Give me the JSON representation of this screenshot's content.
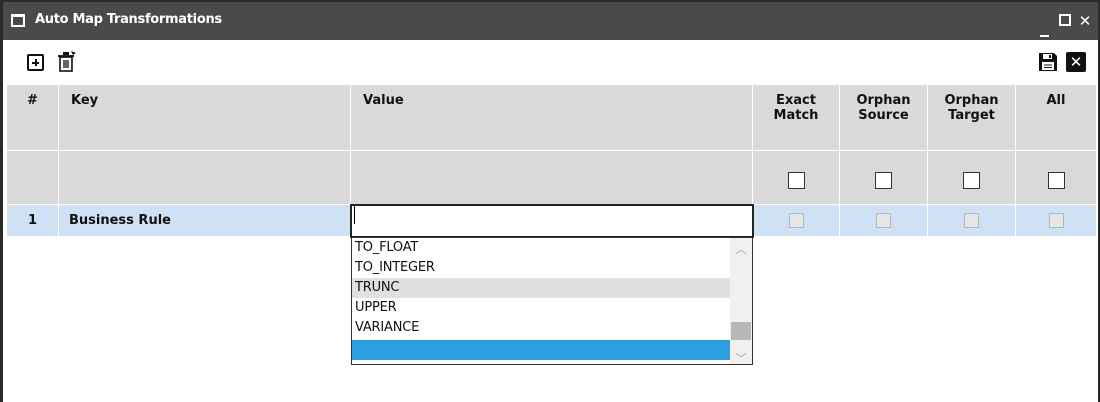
{
  "window": {
    "title": "Auto Map Transformations",
    "controls": [
      "minimize",
      "maximize",
      "close"
    ]
  },
  "toolbar": {
    "add_icon": "add-square-icon",
    "delete_icon": "trash-icon",
    "save_icon": "floppy-disk-icon",
    "close_icon": "close-x-icon"
  },
  "grid": {
    "columns": [
      {
        "key": "num",
        "label": "#"
      },
      {
        "key": "key",
        "label": "Key"
      },
      {
        "key": "value",
        "label": "Value"
      },
      {
        "key": "exact_match",
        "label": "Exact Match"
      },
      {
        "key": "orphan_source",
        "label": "Orphan Source"
      },
      {
        "key": "orphan_target",
        "label": "Orphan Target"
      },
      {
        "key": "all",
        "label": "All"
      }
    ],
    "rows": [
      {
        "num": "1",
        "key": "Business Rule",
        "value": "",
        "exact_match": false,
        "orphan_source": false,
        "orphan_target": false,
        "all": false
      }
    ]
  },
  "dropdown": {
    "options": [
      "TO_FLOAT",
      "TO_INTEGER",
      "TRUNC",
      "UPPER",
      "VARIANCE",
      ""
    ],
    "hovered": "TRUNC",
    "selected_index": 5
  },
  "colors": {
    "titlebar": "#4a4a4a",
    "header": "#d9d9d9",
    "row_selected": "#cfe2f5",
    "option_selected": "#2d9fe0"
  }
}
